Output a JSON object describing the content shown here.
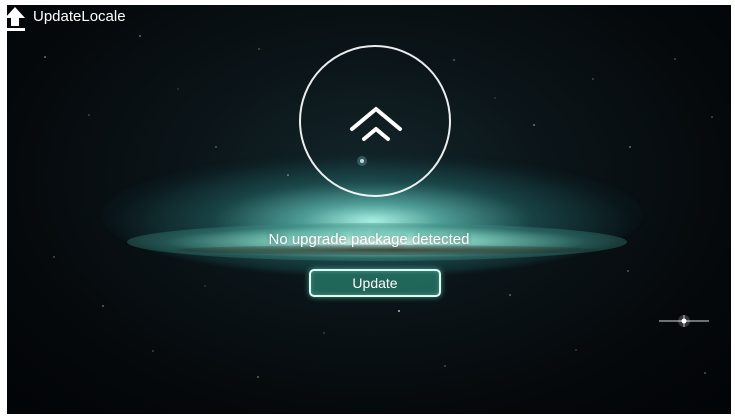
{
  "app": {
    "title": "UpdateLocale",
    "title_icon": "upload-arrow-icon"
  },
  "main": {
    "status_message": "No upgrade package detected",
    "update_button_label": "Update",
    "upgrade_icon": "double-chevron-up-icon"
  },
  "colors": {
    "accent": "#247868",
    "button_border": "#d8fff4",
    "text": "#ffffff",
    "background": "#05090c"
  }
}
